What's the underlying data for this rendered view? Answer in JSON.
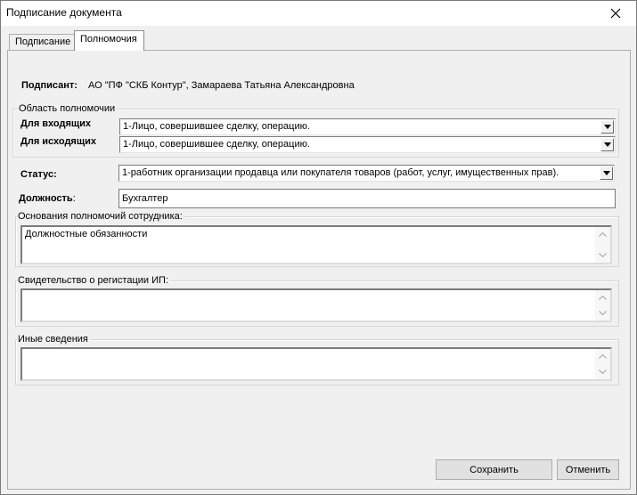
{
  "window": {
    "title": "Подписание документа"
  },
  "tabs": [
    {
      "label": "Подписание"
    },
    {
      "label": "Полномочия"
    }
  ],
  "signer": {
    "label": "Подписант:",
    "value": "АО \"ПФ \"СКБ Контур\", Замараева Татьяна Александровна"
  },
  "authority": {
    "legend": "Область полномочии",
    "incoming": {
      "label": "Для входящих",
      "value": "1-Лицо, совершившее сделку, операцию."
    },
    "outgoing": {
      "label": "Для исходящих",
      "value": "1-Лицо, совершившее сделку, операцию."
    }
  },
  "status": {
    "label": "Статус:",
    "value": "1-работник организации продавца или покупателя товаров (работ, услуг, имущественных прав)."
  },
  "position": {
    "label_bold": "Должность",
    "label_colon": ":",
    "value": "Бухгалтер"
  },
  "grounds": {
    "legend": "Основания полномочий сотрудника:",
    "value": "Должностные обязанности"
  },
  "certificate": {
    "legend": "Свидетельство о регистации ИП:",
    "value": ""
  },
  "other": {
    "legend": "Иные сведения",
    "value": ""
  },
  "buttons": {
    "save": "Сохранить",
    "cancel": "Отменить"
  },
  "icons": {
    "close": "close-icon",
    "dropdown": "triangle-down-icon",
    "scroll_up": "chevron-up-icon",
    "scroll_down": "chevron-down-icon"
  }
}
